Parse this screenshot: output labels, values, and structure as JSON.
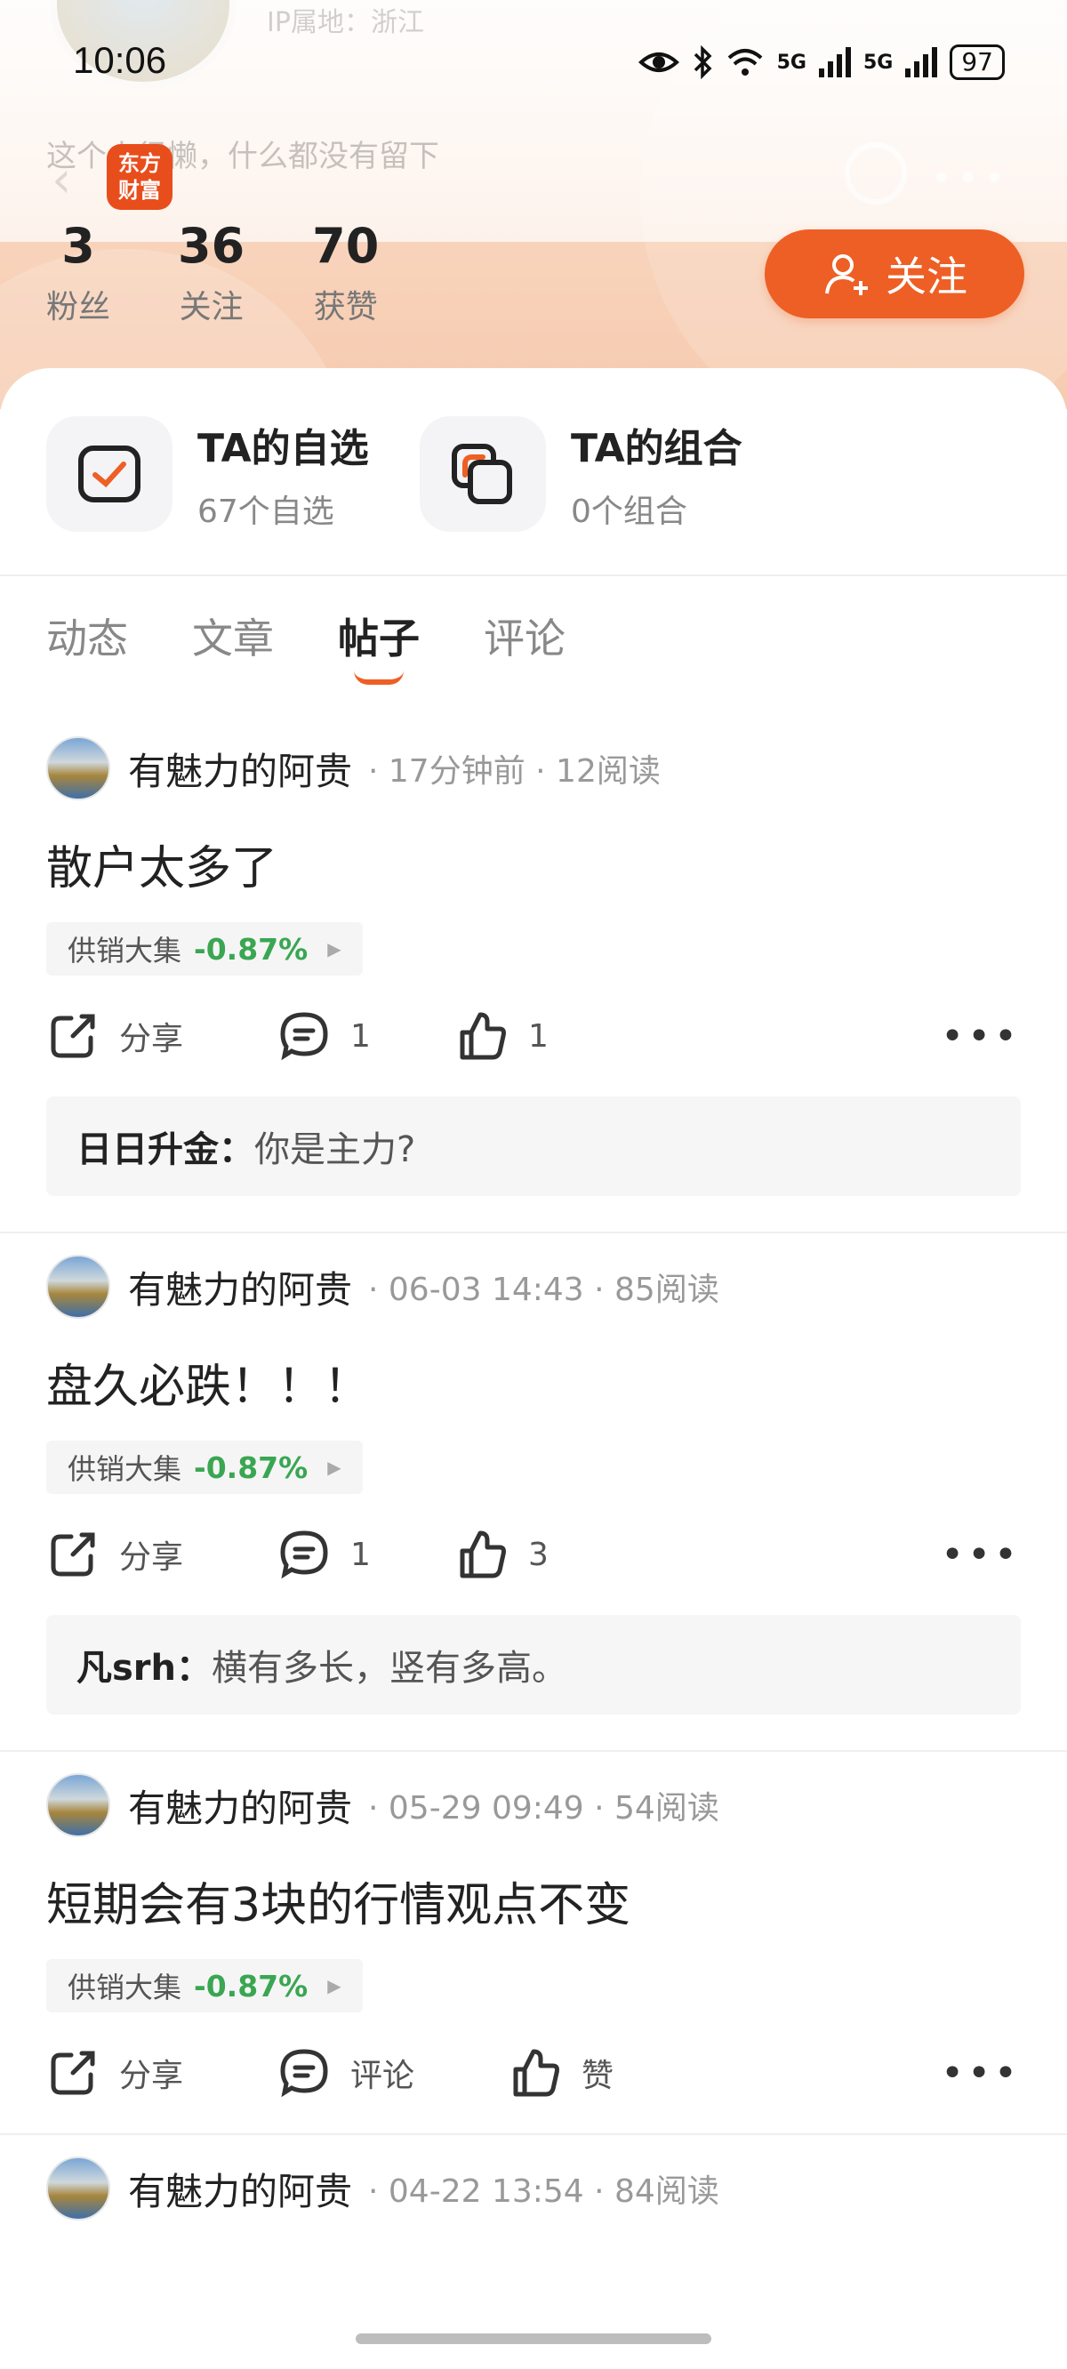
{
  "status_bar": {
    "time": "10:06",
    "network1": "5G",
    "network2": "5G",
    "battery": "97"
  },
  "app": {
    "logo_line1": "东方",
    "logo_line2": "财富"
  },
  "background": {
    "ghost_ip": "IP属地：浙江",
    "ghost_bio": "这个人很懒，什么都没有留下"
  },
  "stats": [
    {
      "num": "3",
      "label": "粉丝"
    },
    {
      "num": "36",
      "label": "关注"
    },
    {
      "num": "70",
      "label": "获赞"
    }
  ],
  "follow_label": "关注",
  "watch": [
    {
      "title": "TA的自选",
      "sub": "67个自选"
    },
    {
      "title": "TA的组合",
      "sub": "0个组合"
    }
  ],
  "tabs": [
    "动态",
    "文章",
    "帖子",
    "评论"
  ],
  "active_tab": "帖子",
  "posts": [
    {
      "author": "有魅力的阿贵",
      "meta": "· 17分钟前 · 12阅读",
      "body": "散户太多了",
      "stock": "供销大集",
      "change": "-0.87%",
      "share": "分享",
      "comments": "1",
      "likes": "1",
      "reply_user": "日日升金：",
      "reply_text": "你是主力?"
    },
    {
      "author": "有魅力的阿贵",
      "meta": "· 06-03 14:43 · 85阅读",
      "body": "盘久必跌！！！",
      "stock": "供销大集",
      "change": "-0.87%",
      "share": "分享",
      "comments": "1",
      "likes": "3",
      "reply_user": "凡srh：",
      "reply_text": "横有多长，竖有多高。"
    },
    {
      "author": "有魅力的阿贵",
      "meta": "· 05-29 09:49 · 54阅读",
      "body": "短期会有3块的行情观点不变",
      "stock": "供销大集",
      "change": "-0.87%",
      "share": "分享",
      "comments": "评论",
      "likes": "赞"
    },
    {
      "author": "有魅力的阿贵",
      "meta": "· 04-22 13:54 · 84阅读"
    }
  ],
  "colors": {
    "accent": "#ee5f25",
    "up_down_green": "#3aa652",
    "logo": "#e84d1c"
  }
}
